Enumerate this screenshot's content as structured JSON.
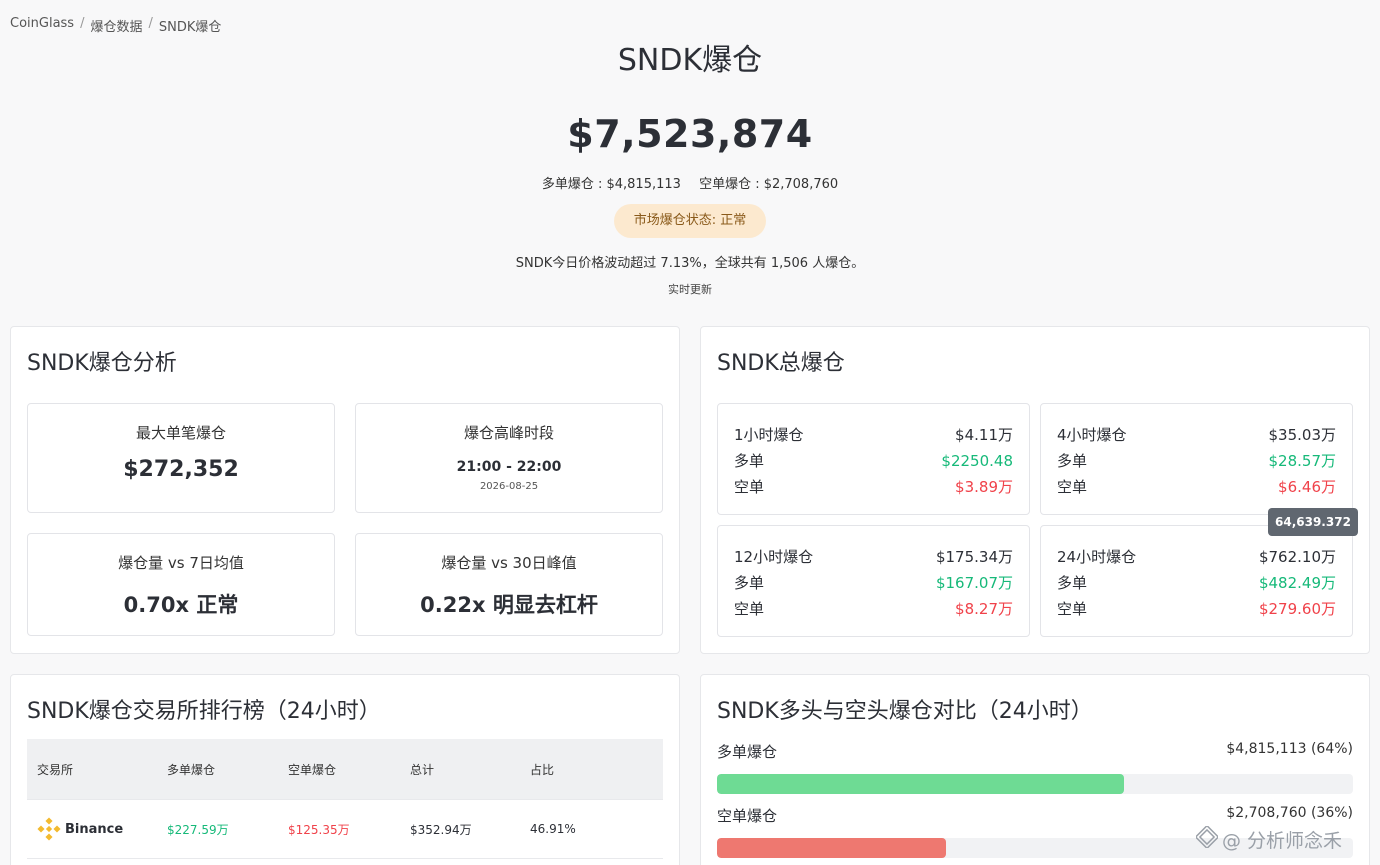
{
  "breadcrumb": [
    "CoinGlass",
    "爆仓数据",
    "SNDK爆仓"
  ],
  "hero": {
    "title": "SNDK爆仓",
    "total": "$7,523,874",
    "long": "多单爆仓 : $4,815,113",
    "short": "空单爆仓 : $2,708,760",
    "status": "市场爆仓状态: 正常",
    "desc": "SNDK今日价格波动超过 7.13%，全球共有 1,506 人爆仓。",
    "live": "实时更新"
  },
  "analysis": {
    "title": "SNDK爆仓分析",
    "max_label": "最大单笔爆仓",
    "max_value": "$272,352",
    "peak_label": "爆仓高峰时段",
    "peak_time": "21:00 - 22:00",
    "peak_date": "2026-08-25",
    "vs7_label": "爆仓量 vs 7日均值",
    "vs7_value": "0.70x 正常",
    "vs30_label": "爆仓量 vs 30日峰值",
    "vs30_value": "0.22x 明显去杠杆"
  },
  "total": {
    "title": "SNDK总爆仓",
    "boxes": [
      {
        "label": "1小时爆仓",
        "total": "$4.11万",
        "long_label": "多单",
        "long": "$2250.48",
        "short_label": "空单",
        "short": "$3.89万"
      },
      {
        "label": "4小时爆仓",
        "total": "$35.03万",
        "long_label": "多单",
        "long": "$28.57万",
        "short_label": "空单",
        "short": "$6.46万"
      },
      {
        "label": "12小时爆仓",
        "total": "$175.34万",
        "long_label": "多单",
        "long": "$167.07万",
        "short_label": "空单",
        "short": "$8.27万"
      },
      {
        "label": "24小时爆仓",
        "total": "$762.10万",
        "long_label": "多单",
        "long": "$482.49万",
        "short_label": "空单",
        "short": "$279.60万"
      }
    ],
    "tooltip": "64,639.372"
  },
  "ranking": {
    "title": "SNDK爆仓交易所排行榜（24小时）",
    "headers": [
      "交易所",
      "多单爆仓",
      "空单爆仓",
      "总计",
      "占比"
    ],
    "rows": [
      {
        "exchange": "Binance",
        "long": "$227.59万",
        "short": "$125.35万",
        "total": "$352.94万",
        "pct": "46.91%"
      }
    ]
  },
  "compare": {
    "title": "SNDK多头与空头爆仓对比（24小时）",
    "long_label": "多单爆仓",
    "long_value": "$4,815,113 (64%)",
    "long_pct": 64,
    "short_label": "空单爆仓",
    "short_value": "$2,708,760 (36%)",
    "short_pct": 36,
    "long_color": "#6edb94",
    "short_color": "#ee7870"
  },
  "watermark": "@ 分析师念禾"
}
